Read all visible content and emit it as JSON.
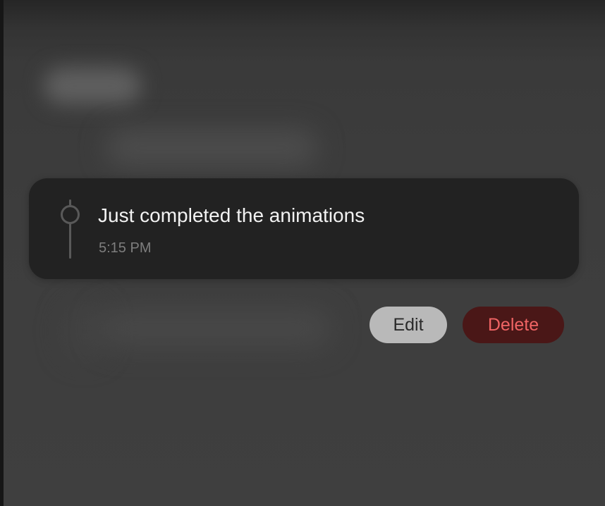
{
  "entry": {
    "text": "Just completed the animations",
    "time": "5:15 PM"
  },
  "actions": {
    "edit_label": "Edit",
    "delete_label": "Delete"
  },
  "colors": {
    "card_background": "#222222",
    "delete_text": "#f06464",
    "delete_background": "#4a1717",
    "edit_background": "#b9b9b9"
  }
}
